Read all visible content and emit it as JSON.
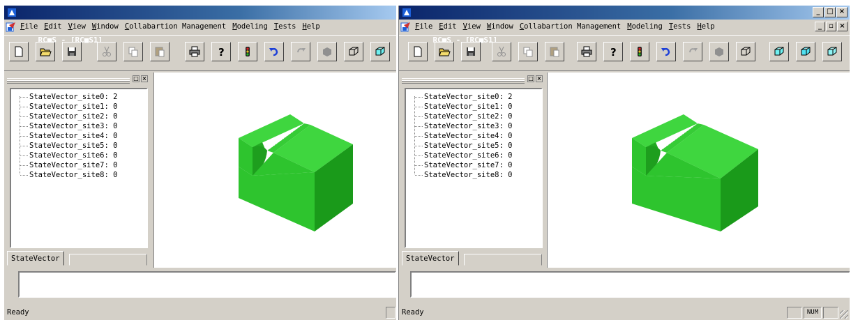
{
  "windows": [
    {
      "title": "RC■S - [RC■S1]",
      "menu": [
        "File",
        "Edit",
        "View",
        "Window",
        "Collabartion Management",
        "Modeling",
        "Tests",
        "Help"
      ],
      "tree_items": [
        "StateVector_site0: 2",
        "StateVector_site1: 0",
        "StateVector_site2: 0",
        "StateVector_site3: 0",
        "StateVector_site4: 0",
        "StateVector_site5: 0",
        "StateVector_site6: 0",
        "StateVector_site7: 0",
        "StateVector_site8: 0"
      ],
      "tab_label": "StateVector",
      "status": "Ready"
    },
    {
      "title": "RC■S - [RC■S1]",
      "menu": [
        "File",
        "Edit",
        "View",
        "Window",
        "Collabartion Management",
        "Modeling",
        "Tests",
        "Help"
      ],
      "tree_items": [
        "StateVector_site0: 2",
        "StateVector_site1: 0",
        "StateVector_site2: 0",
        "StateVector_site3: 0",
        "StateVector_site4: 0",
        "StateVector_site5: 0",
        "StateVector_site6: 0",
        "StateVector_site7: 0",
        "StateVector_site8: 0"
      ],
      "tab_label": "StateVector",
      "status": "Ready",
      "status_num": "NUM"
    }
  ],
  "icons": {
    "toolbar": [
      "new-file-icon",
      "open-folder-icon",
      "save-icon",
      "cut-icon",
      "copy-icon",
      "paste-icon",
      "print-icon",
      "help-icon",
      "traffic-light-icon",
      "undo-icon",
      "redo-icon",
      "solid-box-icon",
      "wireframe-box-icon",
      "cyan-box-icon",
      "cyan-box-2-icon",
      "cyan-box-3-icon"
    ]
  },
  "colors": {
    "titlebar": "#0a246a",
    "model_front": "#2ec42e",
    "model_top": "#3fd63f",
    "model_side": "#1a9a1a",
    "face": "#d4d0c8"
  }
}
